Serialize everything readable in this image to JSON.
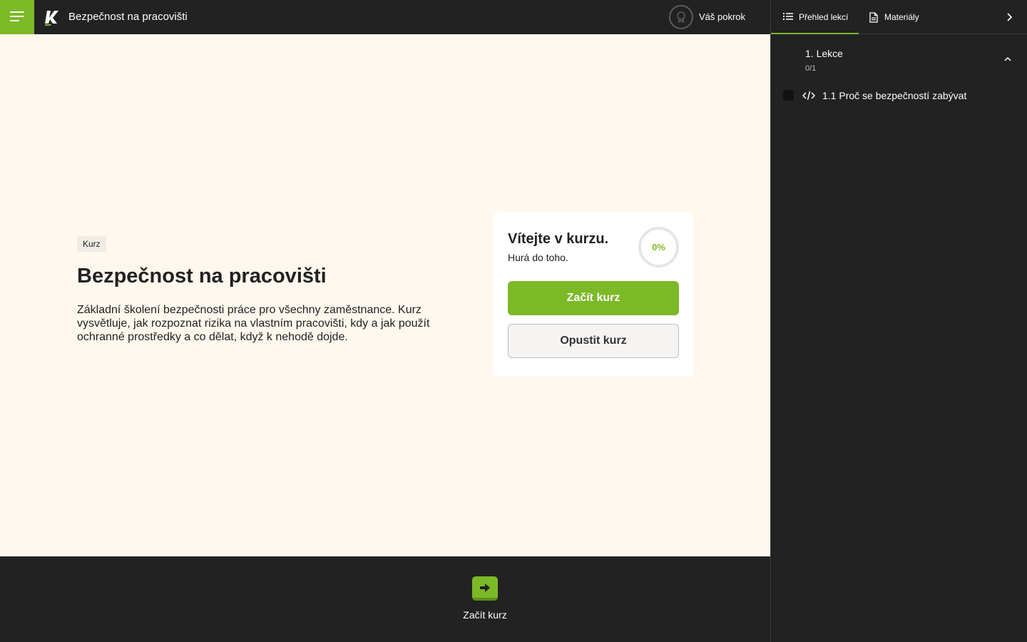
{
  "header": {
    "course_title": "Bezpečnost na pracovišti",
    "progress_label": "Váš pokrok"
  },
  "hero": {
    "tag": "Kurz",
    "title": "Bezpečnost na pracovišti",
    "description": "Základní školení bezpečnosti práce pro všechny zaměstnance. Kurz vysvětluje, jak rozpoznat rizika na vlastním pracovišti, kdy a jak použít ochranné prostředky a co dělat, když k nehodě dojde."
  },
  "card": {
    "welcome": "Vítejte v kurzu.",
    "subtitle": "Hurá do toho.",
    "progress_percent": "0%",
    "start_label": "Začít kurz",
    "leave_label": "Opustit kurz"
  },
  "bottom": {
    "action_label": "Začít kurz"
  },
  "sidebar": {
    "tabs": [
      {
        "label": "Přehled lekcí",
        "icon": "list-icon",
        "active": true
      },
      {
        "label": "Materiály",
        "icon": "document-icon",
        "active": false
      }
    ],
    "sections": [
      {
        "title": "1. Lekce",
        "count": "0/1",
        "lessons": [
          {
            "label": "1.1 Proč se bezpečností zabývat",
            "icon": "code-icon",
            "completed": false
          }
        ]
      }
    ]
  },
  "colors": {
    "accent": "#7cb927",
    "dark": "#222222",
    "content_bg": "#fff8ee"
  }
}
